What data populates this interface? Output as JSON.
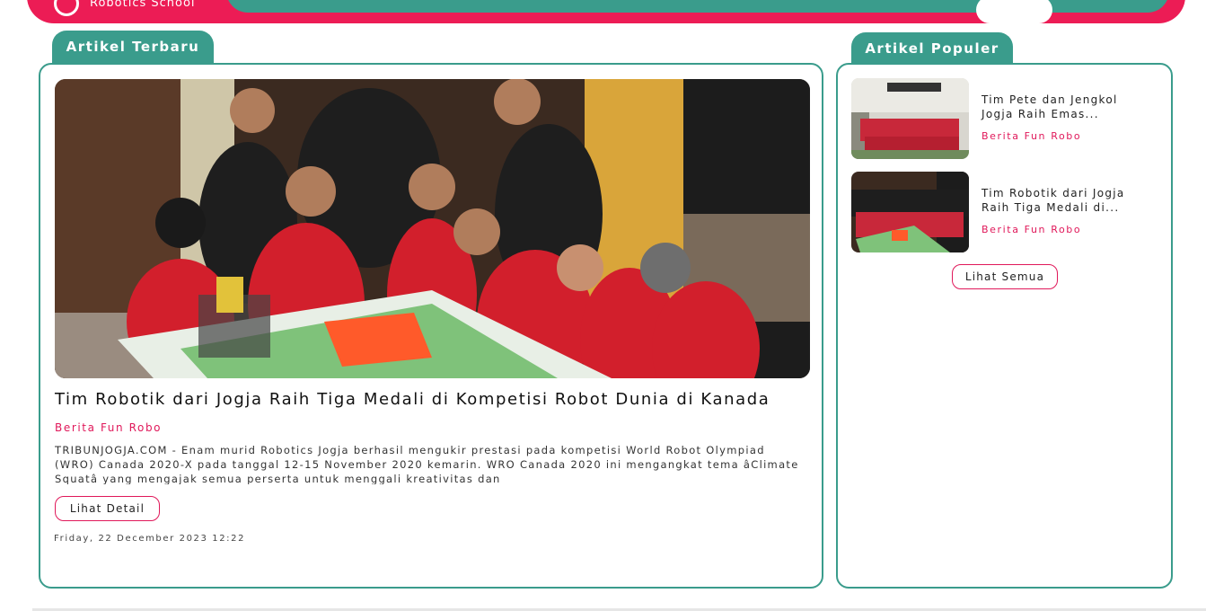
{
  "header": {
    "logo_text": "Robotics School"
  },
  "latest": {
    "tab_label": "Artikel Terbaru",
    "title": "Tim Robotik dari Jogja Raih Tiga Medali di Kompetisi Robot Dunia di Kanada",
    "category": "Berita Fun Robo",
    "excerpt": "TRIBUNJOGJA.COM - Enam murid Robotics Jogja berhasil mengukir prestasi pada kompetisi World Robot Olympiad (WRO) Canada 2020-X pada tanggal 12-15 November 2020 kemarin. WRO Canada 2020 ini mengangkat tema âClimate Squatâ yang mengajak semua perserta untuk menggali kreativitas dan",
    "detail_button": "Lihat Detail",
    "date": "Friday, 22 December 2023  12:22"
  },
  "popular": {
    "tab_label": "Artikel Populer",
    "items": [
      {
        "title": "Tim Pete dan Jengkol Jogja Raih Emas...",
        "category": "Berita Fun Robo"
      },
      {
        "title": "Tim Robotik dari Jogja Raih Tiga Medali di...",
        "category": "Berita Fun Robo"
      }
    ],
    "all_button": "Lihat Semua"
  },
  "colors": {
    "brand_pink": "#ec1c55",
    "brand_teal": "#3a9c8c",
    "accent_text": "#e0185a"
  }
}
